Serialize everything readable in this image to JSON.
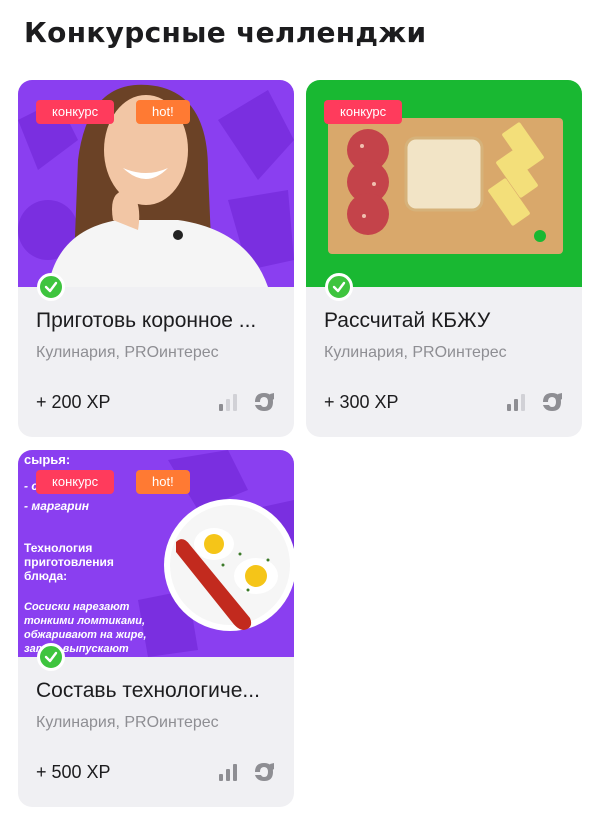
{
  "page": {
    "title": "Конкурсные челленджи"
  },
  "colors": {
    "contest_badge": "#ff3b5c",
    "hot_badge": "#ff7a33",
    "check": "#3ec43e",
    "card_bg": "#f0f0f3"
  },
  "cards": [
    {
      "badges": {
        "contest": "конкурс",
        "hot": "hot!"
      },
      "title": "Приготовь коронное ...",
      "tags": "Кулинария, PROинтерес",
      "xp": "+ 200 XP",
      "difficulty_level": 1
    },
    {
      "badges": {
        "contest": "конкурс"
      },
      "title": "Рассчитай КБЖУ",
      "tags": "Кулинария, PROинтерес",
      "xp": "+ 300 XP",
      "difficulty_level": 2
    },
    {
      "badges": {
        "contest": "конкурс",
        "hot": "hot!"
      },
      "title": "Составь технологиче...",
      "tags": "Кулинария, PROинтерес",
      "xp": "+ 500 XP",
      "difficulty_level": 3,
      "image_text": {
        "line1": "сырья:",
        "line2": "- сосиски",
        "line3": "- маргарин",
        "line4": "Технология",
        "line5": "приготовления",
        "line6": "блюда:",
        "line7": "Сосиски нарезают",
        "line8": "тонкими ломтиками,",
        "line9": "обжаривают на жире,",
        "line10": "затем выпускают"
      }
    }
  ]
}
